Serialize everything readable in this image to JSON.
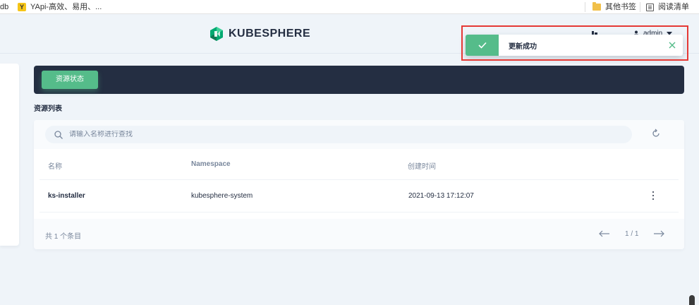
{
  "bookmarks_bar": {
    "items": [
      {
        "label": "db"
      },
      {
        "label": "YApi-高效、易用、..."
      }
    ],
    "yapi_icon_letter": "Y",
    "other_bookmarks": "其他书签",
    "reading_list": "阅读清单"
  },
  "header": {
    "logo_text": "KUBESPHERE",
    "user": "admin"
  },
  "notification": {
    "message": "更新成功",
    "type": "success",
    "icons": {
      "status": "check-icon",
      "close": "close-icon"
    }
  },
  "banner": {
    "tab_label": "资源状态"
  },
  "resources": {
    "section_title": "资源列表",
    "search": {
      "placeholder": "请输入名称进行查找",
      "value": ""
    },
    "columns": {
      "name": "名称",
      "namespace": "Namespace",
      "created": "创建时间"
    },
    "rows": [
      {
        "name": "ks-installer",
        "namespace": "kubesphere-system",
        "created": "2021-09-13 17:12:07"
      }
    ],
    "total_text": "共 1 个条目",
    "pagination": "1 / 1"
  },
  "colors": {
    "accent_green": "#55bc8a",
    "dark_navy": "#242e42",
    "background": "#eff4f9",
    "muted_text": "#79879c",
    "highlight_red": "#e53935"
  }
}
